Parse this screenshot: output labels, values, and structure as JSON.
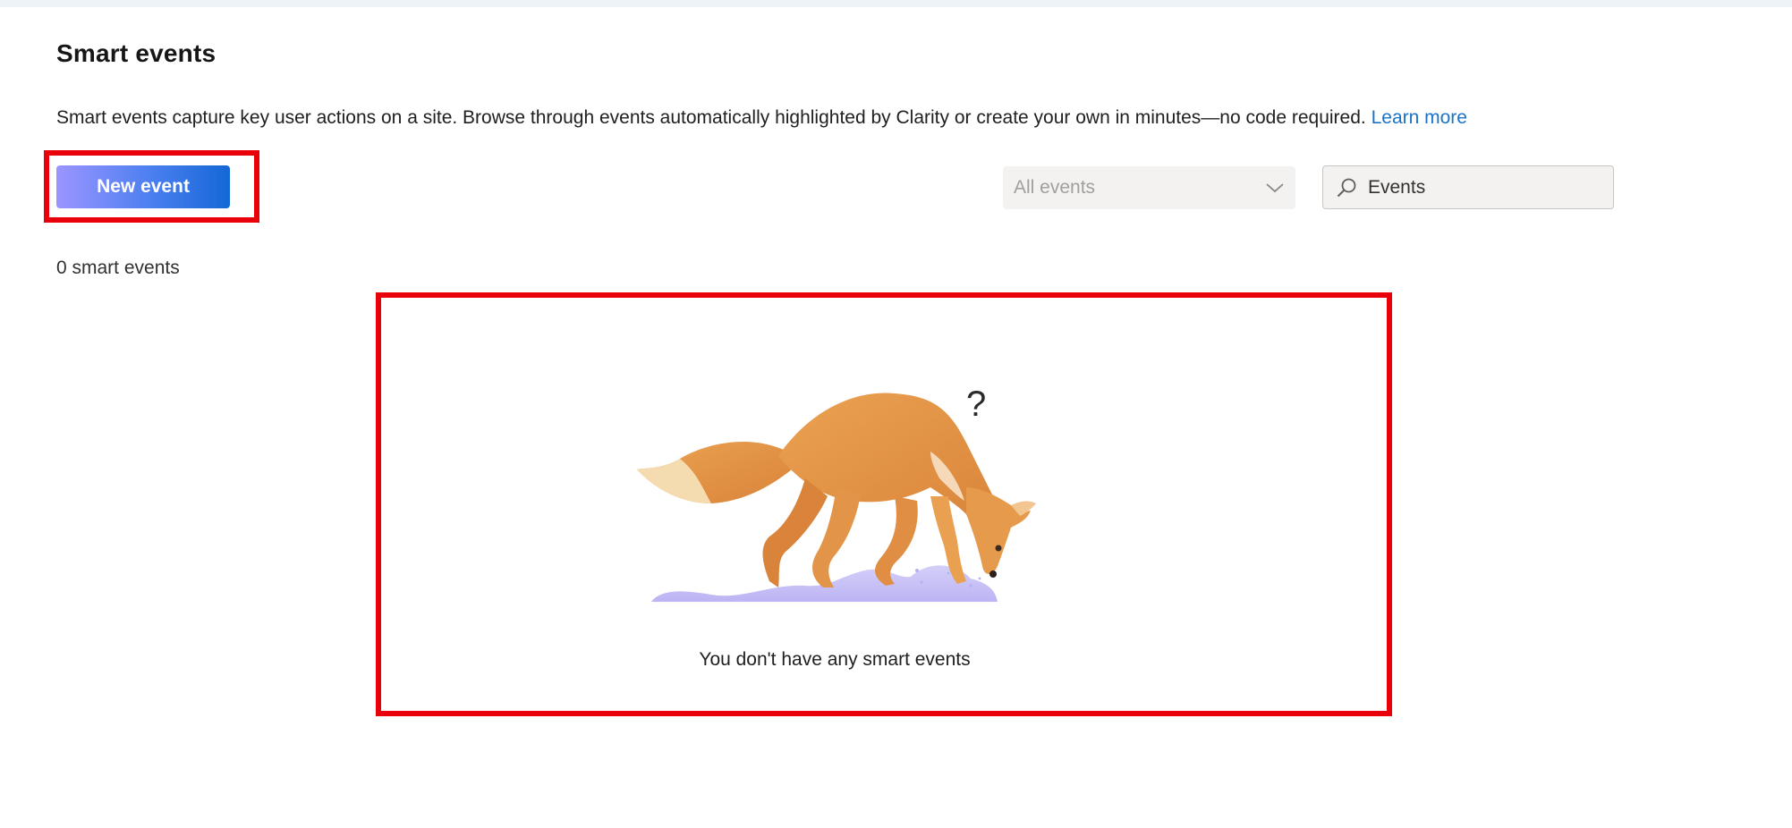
{
  "header": {
    "title": "Smart events",
    "description": "Smart events capture key user actions on a site. Browse through events automatically highlighted by Clarity or create your own in minutes—no code required.",
    "learn_more": "Learn more"
  },
  "toolbar": {
    "new_event_label": "New event",
    "filter": {
      "selected": "All events",
      "icon": "chevron-down-icon"
    },
    "search": {
      "placeholder": "Events",
      "icon": "search-icon"
    }
  },
  "summary": {
    "count_label": "0 smart events"
  },
  "empty_state": {
    "message": "You don't have any smart events",
    "question_mark": "?"
  },
  "colors": {
    "accent": "#1467d6",
    "button_gradient_start": "#9c95ff",
    "link": "#1a73c8",
    "highlight": "#e8000b",
    "fox": "#e0913f",
    "snow": "#c9c3f7"
  }
}
